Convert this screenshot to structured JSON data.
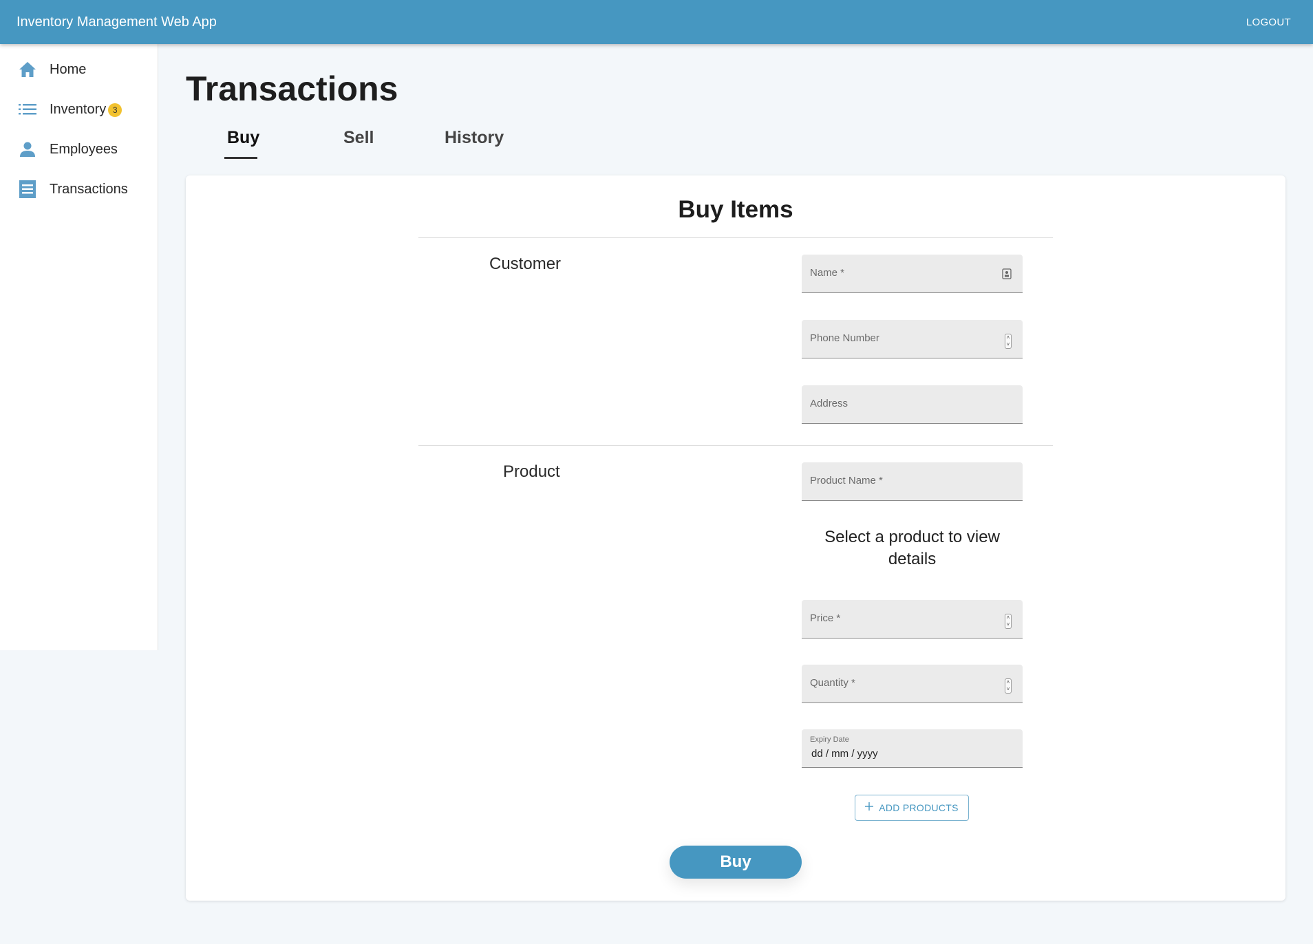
{
  "appbar": {
    "title": "Inventory Management Web App",
    "logout_label": "LOGOUT"
  },
  "sidebar": {
    "items": [
      {
        "label": "Home",
        "icon": "home-icon"
      },
      {
        "label": "Inventory",
        "icon": "list-icon",
        "badge": "3"
      },
      {
        "label": "Employees",
        "icon": "person-icon"
      },
      {
        "label": "Transactions",
        "icon": "receipt-icon"
      }
    ]
  },
  "page": {
    "title": "Transactions"
  },
  "tabs": [
    {
      "label": "Buy",
      "active": true
    },
    {
      "label": "Sell",
      "active": false
    },
    {
      "label": "History",
      "active": false
    }
  ],
  "card": {
    "title": "Buy Items",
    "customer": {
      "section_label": "Customer",
      "fields": [
        {
          "label": "Name *",
          "value": ""
        },
        {
          "label": "Phone Number",
          "value": ""
        },
        {
          "label": "Address",
          "value": ""
        }
      ]
    },
    "product": {
      "section_label": "Product",
      "product_name_label": "Product Name *",
      "helper_text": "Select a product to view details",
      "price_label": "Price *",
      "quantity_label": "Quantity *",
      "expiry_label": "Expiry Date",
      "expiry_placeholder": "dd / mm / yyyy",
      "add_products_label": "ADD PRODUCTS"
    },
    "buy_button_label": "Buy"
  },
  "colors": {
    "primary": "#4697c1",
    "background": "#f3f7fa",
    "badge": "#f2c230",
    "field_bg": "#ebebeb"
  }
}
